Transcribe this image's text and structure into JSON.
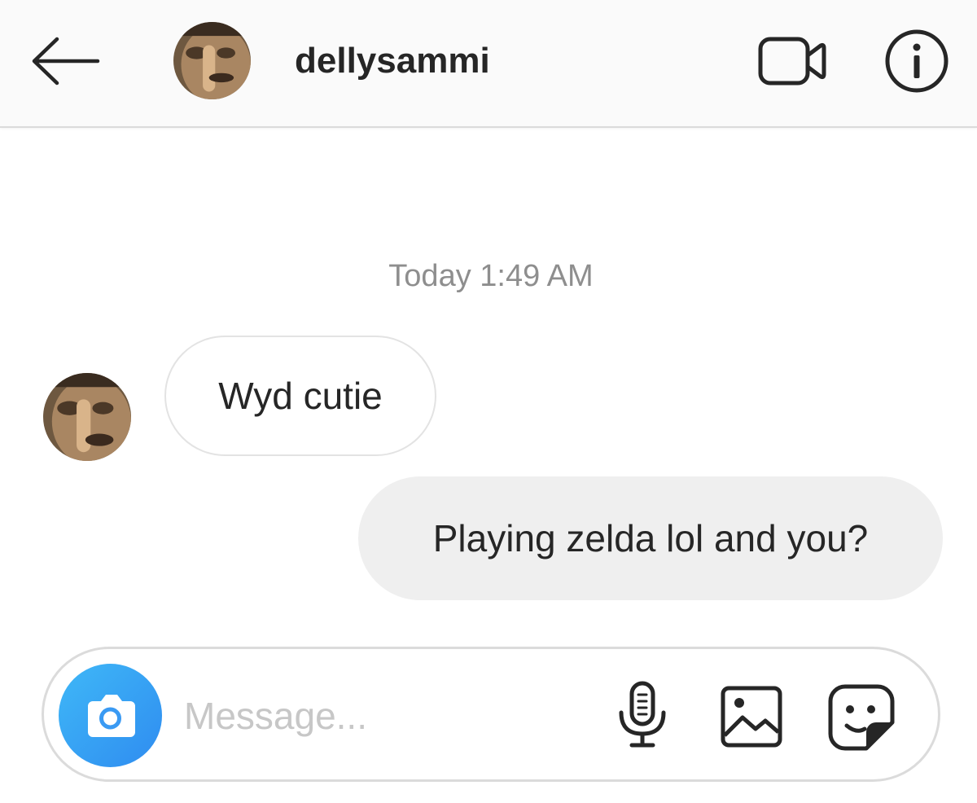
{
  "header": {
    "username": "dellysammi",
    "icons": {
      "back": "arrow-left-icon",
      "video": "video-camera-icon",
      "info": "info-icon"
    }
  },
  "conversation": {
    "timestamp": "Today 1:49 AM",
    "messages": [
      {
        "from": "them",
        "text": "Wyd cutie"
      },
      {
        "from": "me",
        "text": "Playing zelda lol and you?"
      }
    ]
  },
  "composer": {
    "placeholder": "Message...",
    "value": "",
    "icons": {
      "camera": "camera-icon",
      "mic": "microphone-icon",
      "gallery": "image-icon",
      "sticker": "sticker-icon"
    }
  },
  "colors": {
    "header_bg": "#fafafa",
    "outgoing_bubble": "#efefef",
    "camera_accent": "#3897f0",
    "text_primary": "#262626",
    "text_muted": "#8e8e8e"
  }
}
